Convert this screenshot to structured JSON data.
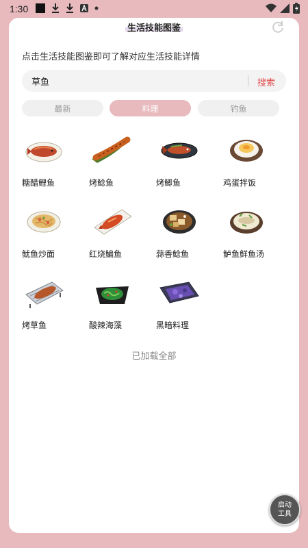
{
  "status_bar": {
    "time": "1:30"
  },
  "header": {
    "title": "生活技能图鉴"
  },
  "subtitle": "点击生活技能图鉴即可了解对应生活技能详情",
  "search": {
    "value": "草鱼",
    "button_label": "搜索"
  },
  "tabs": [
    {
      "label": "最新",
      "active": false
    },
    {
      "label": "料理",
      "active": true
    },
    {
      "label": "钓鱼",
      "active": false
    }
  ],
  "items": [
    {
      "label": "糖醋鲤鱼",
      "icon": "sweet-sour-carp-dish"
    },
    {
      "label": "烤鲶鱼",
      "icon": "grilled-catfish-dish"
    },
    {
      "label": "烤鲫鱼",
      "icon": "grilled-crucian-dish"
    },
    {
      "label": "鸡蛋拌饭",
      "icon": "egg-rice-dish"
    },
    {
      "label": "鱿鱼炒面",
      "icon": "squid-noodles-dish"
    },
    {
      "label": "红烧鳊鱼",
      "icon": "braised-bream-dish"
    },
    {
      "label": "蒜香鲶鱼",
      "icon": "garlic-catfish-dish"
    },
    {
      "label": "鲈鱼鲜鱼汤",
      "icon": "perch-soup-dish"
    },
    {
      "label": "烤草鱼",
      "icon": "grilled-grass-carp-dish"
    },
    {
      "label": "酸辣海藻",
      "icon": "spicy-seaweed-dish"
    },
    {
      "label": "黑暗料理",
      "icon": "dark-cuisine-dish"
    }
  ],
  "footer_note": "已加载全部",
  "floating_button": {
    "line1": "启动",
    "line2": "工具"
  },
  "colors": {
    "accent": "#e8b9bd",
    "search_button": "#e14c4c"
  }
}
